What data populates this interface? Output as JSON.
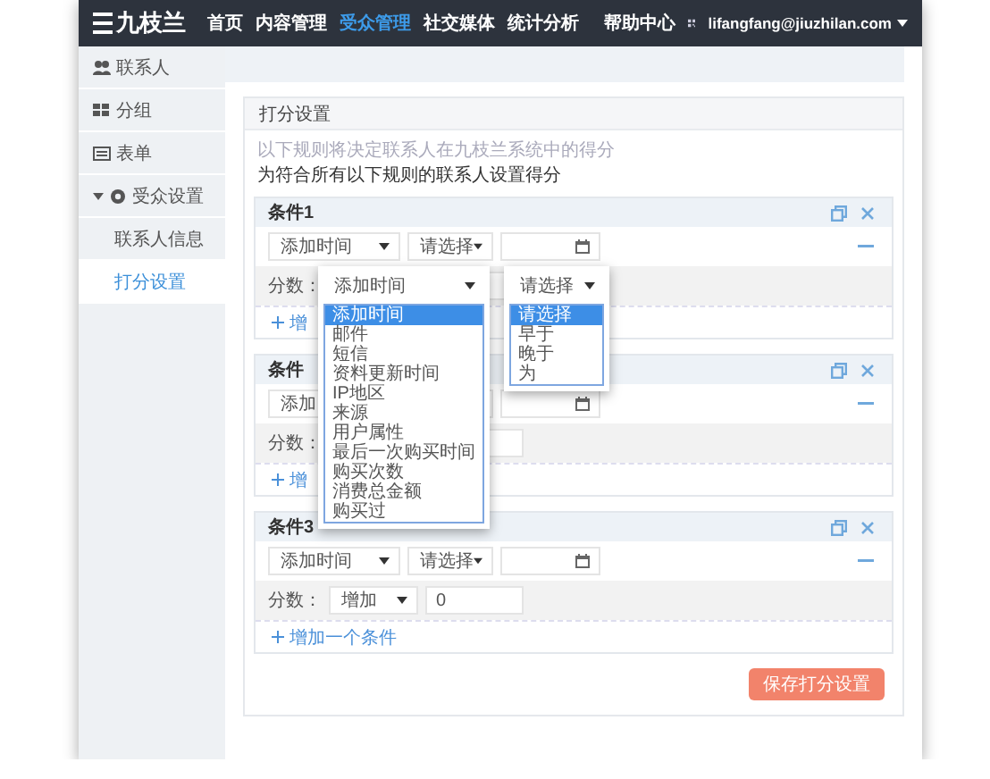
{
  "nav": {
    "logo": "九枝兰",
    "items": [
      {
        "label": "首页",
        "selected": false
      },
      {
        "label": "内容管理",
        "selected": false
      },
      {
        "label": "受众管理",
        "selected": true
      },
      {
        "label": "社交媒体",
        "selected": false
      },
      {
        "label": "统计分析",
        "selected": false
      }
    ],
    "help": "帮助中心",
    "user": "lifangfang@jiuzhilan.com"
  },
  "sidebar": {
    "items": [
      {
        "label": "联系人",
        "kind": "contacts"
      },
      {
        "label": "分组",
        "kind": "groups"
      },
      {
        "label": "表单",
        "kind": "forms"
      },
      {
        "label": "受众设置",
        "kind": "settings",
        "expanded": true,
        "children": [
          {
            "label": "联系人信息",
            "selected": false
          },
          {
            "label": "打分设置",
            "selected": true
          }
        ]
      }
    ]
  },
  "panel": {
    "title": "打分设置",
    "hint": "以下规则将决定联系人在九枝兰系统中的得分",
    "instruction": "为符合所有以下规则的联系人设置得分",
    "conditions": [
      {
        "title": "条件1",
        "field": "添加时间",
        "operator": "请选择",
        "score_label": "分数：",
        "add_link": "增"
      },
      {
        "title": "条件",
        "field": "添加",
        "score_label": "分数：",
        "add_link": "增"
      },
      {
        "title": "条件3",
        "field": "添加时间",
        "operator": "请选择",
        "score_label": "分数：",
        "score_operator": "增加",
        "score_value": "0",
        "add_link": "增加一个条件"
      }
    ],
    "save_button": "保存打分设置"
  },
  "dropdowns": [
    {
      "value": "添加时间",
      "options": [
        {
          "label": "添加时间",
          "selected": true
        },
        {
          "label": "邮件",
          "selected": false
        },
        {
          "label": "短信",
          "selected": false
        },
        {
          "label": "资料更新时间",
          "selected": false
        },
        {
          "label": "IP地区",
          "selected": false
        },
        {
          "label": "来源",
          "selected": false
        },
        {
          "label": "用户属性",
          "selected": false
        },
        {
          "label": "最后一次购买时间",
          "selected": false
        },
        {
          "label": "购买次数",
          "selected": false
        },
        {
          "label": "消费总金额",
          "selected": false
        },
        {
          "label": "购买过",
          "selected": false
        }
      ]
    },
    {
      "value": "请选择",
      "options": [
        {
          "label": "请选择",
          "selected": true
        },
        {
          "label": "早于",
          "selected": false
        },
        {
          "label": "晚于",
          "selected": false
        },
        {
          "label": "为",
          "selected": false
        }
      ]
    }
  ]
}
